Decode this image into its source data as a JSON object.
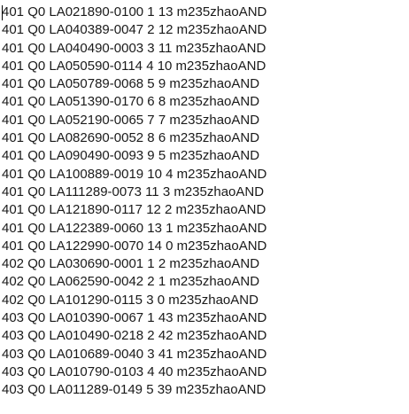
{
  "editor": {
    "lines": [
      "401 Q0 LA021890-0100 1 13 m235zhaoAND",
      "401 Q0 LA040389-0047 2 12 m235zhaoAND",
      "401 Q0 LA040490-0003 3 11 m235zhaoAND",
      "401 Q0 LA050590-0114 4 10 m235zhaoAND",
      "401 Q0 LA050789-0068 5 9 m235zhaoAND",
      "401 Q0 LA051390-0170 6 8 m235zhaoAND",
      "401 Q0 LA052190-0065 7 7 m235zhaoAND",
      "401 Q0 LA082690-0052 8 6 m235zhaoAND",
      "401 Q0 LA090490-0093 9 5 m235zhaoAND",
      "401 Q0 LA100889-0019 10 4 m235zhaoAND",
      "401 Q0 LA111289-0073 11 3 m235zhaoAND",
      "401 Q0 LA121890-0117 12 2 m235zhaoAND",
      "401 Q0 LA122389-0060 13 1 m235zhaoAND",
      "401 Q0 LA122990-0070 14 0 m235zhaoAND",
      "402 Q0 LA030690-0001 1 2 m235zhaoAND",
      "402 Q0 LA062590-0042 2 1 m235zhaoAND",
      "402 Q0 LA101290-0115 3 0 m235zhaoAND",
      "403 Q0 LA010390-0067 1 43 m235zhaoAND",
      "403 Q0 LA010490-0218 2 42 m235zhaoAND",
      "403 Q0 LA010689-0040 3 41 m235zhaoAND",
      "403 Q0 LA010790-0103 4 40 m235zhaoAND",
      "403 Q0 LA011289-0149 5 39 m235zhaoAND"
    ]
  }
}
